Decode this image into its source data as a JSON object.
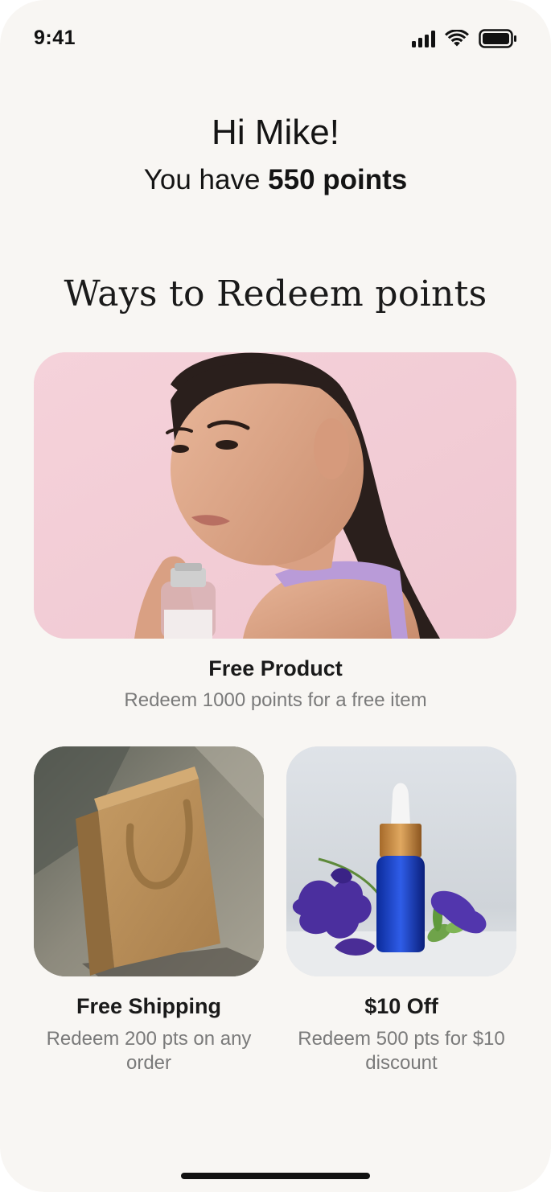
{
  "status_bar": {
    "time": "9:41"
  },
  "header": {
    "greeting": "Hi Mike!",
    "points_prefix": "You have",
    "points_value": "550 points"
  },
  "section": {
    "title": "Ways to Redeem points"
  },
  "rewards": [
    {
      "title": "Free Product",
      "description": "Redeem 1000 points for a free item",
      "image": "woman-holding-bottle-photo"
    },
    {
      "title": "Free Shipping",
      "description": "Redeem 200 pts on any order",
      "image": "paper-bag-photo"
    },
    {
      "title": "$10 Off",
      "description": "Redeem 500 pts for $10 discount",
      "image": "serum-bottle-flowers-photo"
    }
  ],
  "colors": {
    "background": "#f8f6f3",
    "hero_bg": "#f4cfd8",
    "text_primary": "#141414",
    "text_secondary": "#7a7a7a"
  }
}
